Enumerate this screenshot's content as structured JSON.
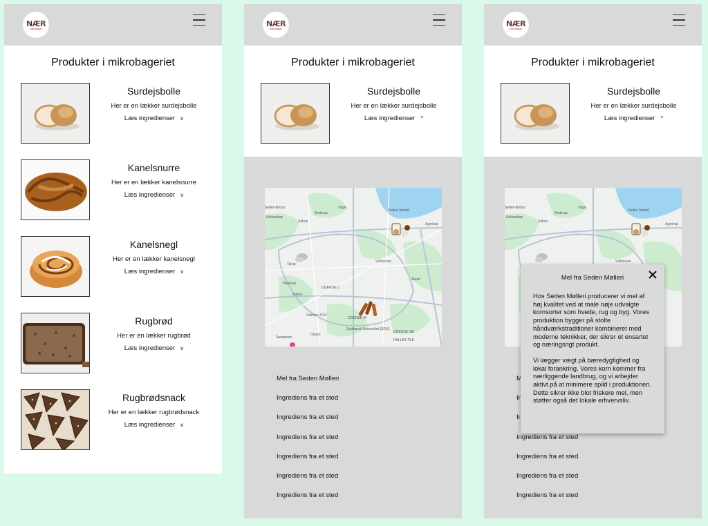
{
  "logo": {
    "word": "NÆR",
    "sub": "mikrobageri"
  },
  "page_title": "Produkter i mikrobageriet",
  "products": [
    {
      "name": "Surdejsbolle",
      "desc": "Her er en lækker surdejsbolle",
      "toggle": "Læs ingredienser"
    },
    {
      "name": "Kanelsnurre",
      "desc": "Her er en lækker kanelsnurre",
      "toggle": "Læs ingredienser"
    },
    {
      "name": "Kanelsnegl",
      "desc": "Her er en lækker kanelsnegl",
      "toggle": "Læs ingredienser"
    },
    {
      "name": "Rugbrød",
      "desc": "Her er en lækker rugbrød",
      "toggle": "Læs ingredienser"
    },
    {
      "name": "Rugbrødsnack",
      "desc": "Her er en lækker rugbrødsnack",
      "toggle": "Læs ingredienser"
    }
  ],
  "chevrons": {
    "collapsed": "v",
    "expanded": "^"
  },
  "map": {
    "labels": {
      "stige": "Stige",
      "seden_strand": "Seden Strand",
      "seden_broby": "Seden-Broby",
      "anderup": "Anderup",
      "kirkendrup": "Kirkendrup",
      "sohus": "Sahus",
      "agedrup": "Agedrup",
      "tarup": "Tarup",
      "vollsmose": "Vollsmose",
      "hojstrup": "Højstrup",
      "odense_c": "ODENSE C",
      "aasum": "Åsum",
      "bolbro": "Bolbro",
      "odense_zoo": "Odense ZOO",
      "odense_m": "ODENSE M",
      "sanderum": "Sanderum",
      "dalum": "Dalum",
      "syddansk": "Syddansk Universitet (SDU)",
      "odense_so": "ODENSE SØ",
      "hallby": "HALLBY PLE"
    }
  },
  "origins": [
    "Mel fra Seden Mølleri",
    "Ingrediens fra et sted",
    "Ingrediens fra et sted",
    "Ingrediens fra et sted",
    "Ingrediens fra et sted",
    "Ingrediens fra et sted",
    "Ingrediens fra et sted"
  ],
  "popup": {
    "title": "Mel fra Seden Mølleri",
    "p1": "Hos Seden Mølleri producerer vi mel af høj kvalitet ved at male nøje udvalgte kornsorter som hvede, rug og byg. Vores produktion bygger på stolte håndværkstraditioner kombineret med moderne teknikker, der sikrer et ensartet og næringsrigt produkt.",
    "p2": "Vi lægger vægt på bæredygtighed og lokal forankring. Vores korn kommer fra nærliggende landbrug, og vi arbejder aktivt på at minimere spild i produktionen. Dette sikrer ikke blot friskere mel, men støtter også det lokale erhvervsliv."
  },
  "colors": {
    "background": "#d9f9e9",
    "topbar": "#d9d9d9",
    "map_green": "#cdeccf",
    "map_water": "#9fd3f2"
  }
}
